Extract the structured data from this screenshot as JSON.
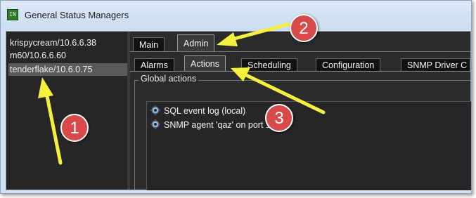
{
  "window": {
    "title": "General Status Managers",
    "icon": "app-logo-icon",
    "icon_text": "IN"
  },
  "hosts": [
    {
      "label": "krispycream/10.6.6.38",
      "selected": false
    },
    {
      "label": "m60/10.6.6.60",
      "selected": false
    },
    {
      "label": "tenderflake/10.6.0.75",
      "selected": true
    }
  ],
  "main_tabs": [
    {
      "label": "Main",
      "active": false
    },
    {
      "label": "Admin",
      "active": true
    }
  ],
  "sub_tabs": [
    {
      "label": "Alarms",
      "active": false
    },
    {
      "label": "Actions",
      "active": true
    },
    {
      "label": "Scheduling",
      "active": false
    },
    {
      "label": "Configuration",
      "active": false
    },
    {
      "label": "SNMP Driver C",
      "active": false
    }
  ],
  "global_actions": {
    "label": "Global actions",
    "items": [
      {
        "label": "SQL event log (local)",
        "icon": "gear-icon"
      },
      {
        "label": "SNMP agent 'qaz' on port 1",
        "icon": "gear-icon"
      }
    ]
  },
  "callouts": [
    {
      "number": "1",
      "color": "#d84a4a"
    },
    {
      "number": "2",
      "color": "#d84a4a"
    },
    {
      "number": "3",
      "color": "#d84a4a"
    }
  ],
  "arrow_color": "#f5f03c"
}
